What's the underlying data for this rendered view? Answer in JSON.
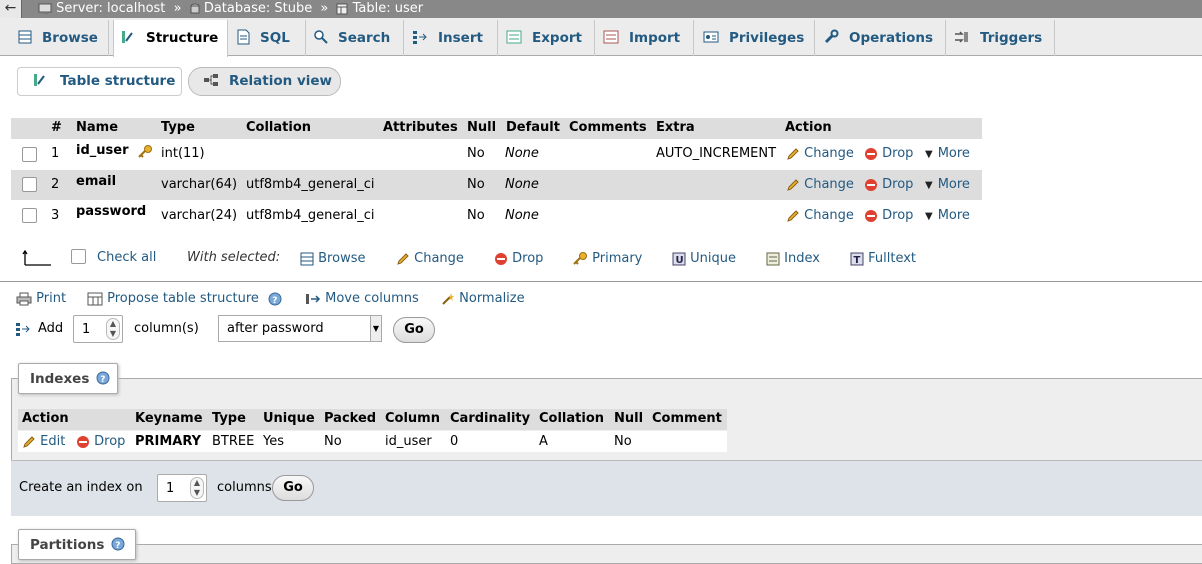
{
  "breadcrumb": {
    "server": "Server: localhost",
    "database": "Database: Stube",
    "table": "Table: user",
    "separator": "»"
  },
  "tabs": [
    {
      "label": "Browse",
      "icon": "browse-icon"
    },
    {
      "label": "Structure",
      "icon": "structure-icon",
      "active": true
    },
    {
      "label": "SQL",
      "icon": "sql-icon"
    },
    {
      "label": "Search",
      "icon": "search-icon"
    },
    {
      "label": "Insert",
      "icon": "insert-icon"
    },
    {
      "label": "Export",
      "icon": "export-icon"
    },
    {
      "label": "Import",
      "icon": "import-icon"
    },
    {
      "label": "Privileges",
      "icon": "privileges-icon"
    },
    {
      "label": "Operations",
      "icon": "operations-icon"
    },
    {
      "label": "Triggers",
      "icon": "triggers-icon"
    }
  ],
  "subtabs": {
    "table_structure": "Table structure",
    "relation_view": "Relation view"
  },
  "structure": {
    "headers": [
      "#",
      "Name",
      "Type",
      "Collation",
      "Attributes",
      "Null",
      "Default",
      "Comments",
      "Extra",
      "Action"
    ],
    "rows": [
      {
        "num": "1",
        "name": "id_user",
        "primary": true,
        "type": "int(11)",
        "collation": "",
        "attributes": "",
        "null": "No",
        "default": "None",
        "comments": "",
        "extra": "AUTO_INCREMENT"
      },
      {
        "num": "2",
        "name": "email",
        "primary": false,
        "type": "varchar(64)",
        "collation": "utf8mb4_general_ci",
        "attributes": "",
        "null": "No",
        "default": "None",
        "comments": "",
        "extra": ""
      },
      {
        "num": "3",
        "name": "password",
        "primary": false,
        "type": "varchar(24)",
        "collation": "utf8mb4_general_ci",
        "attributes": "",
        "null": "No",
        "default": "None",
        "comments": "",
        "extra": ""
      }
    ],
    "row_actions": {
      "change": "Change",
      "drop": "Drop",
      "more": "More"
    }
  },
  "bulk": {
    "check_all": "Check all",
    "with_selected": "With selected:",
    "actions": [
      "Browse",
      "Change",
      "Drop",
      "Primary",
      "Unique",
      "Index",
      "Fulltext"
    ]
  },
  "tools": {
    "print": "Print",
    "propose": "Propose table structure",
    "move_columns": "Move columns",
    "normalize": "Normalize"
  },
  "add_columns": {
    "label": "Add",
    "count": "1",
    "unit": "column(s)",
    "position": "after password",
    "go": "Go"
  },
  "indexes": {
    "legend": "Indexes",
    "headers": [
      "Action",
      "Keyname",
      "Type",
      "Unique",
      "Packed",
      "Column",
      "Cardinality",
      "Collation",
      "Null",
      "Comment"
    ],
    "rows": [
      {
        "edit": "Edit",
        "drop": "Drop",
        "keyname": "PRIMARY",
        "type": "BTREE",
        "unique": "Yes",
        "packed": "No",
        "column": "id_user",
        "cardinality": "0",
        "collation": "A",
        "null": "No",
        "comment": ""
      }
    ],
    "create_label": "Create an index on",
    "create_count": "1",
    "create_unit": "columns",
    "go": "Go"
  },
  "partitions": {
    "legend": "Partitions"
  }
}
